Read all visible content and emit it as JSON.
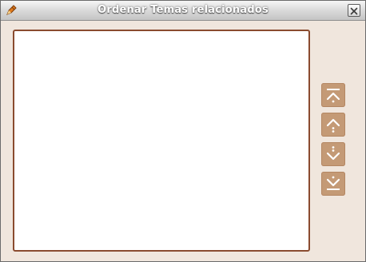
{
  "window": {
    "title": "Ordenar Temas relacionados",
    "app_icon": "app-pen-icon",
    "close_icon": "close-icon"
  },
  "list": {
    "items": []
  },
  "buttons": [
    {
      "icon": "move-top-icon"
    },
    {
      "icon": "move-up-icon"
    },
    {
      "icon": "move-down-icon"
    },
    {
      "icon": "move-bottom-icon"
    }
  ],
  "colors": {
    "background": "#f0e6dd",
    "list_border": "#8a4b2f",
    "button": "#c49a76"
  }
}
